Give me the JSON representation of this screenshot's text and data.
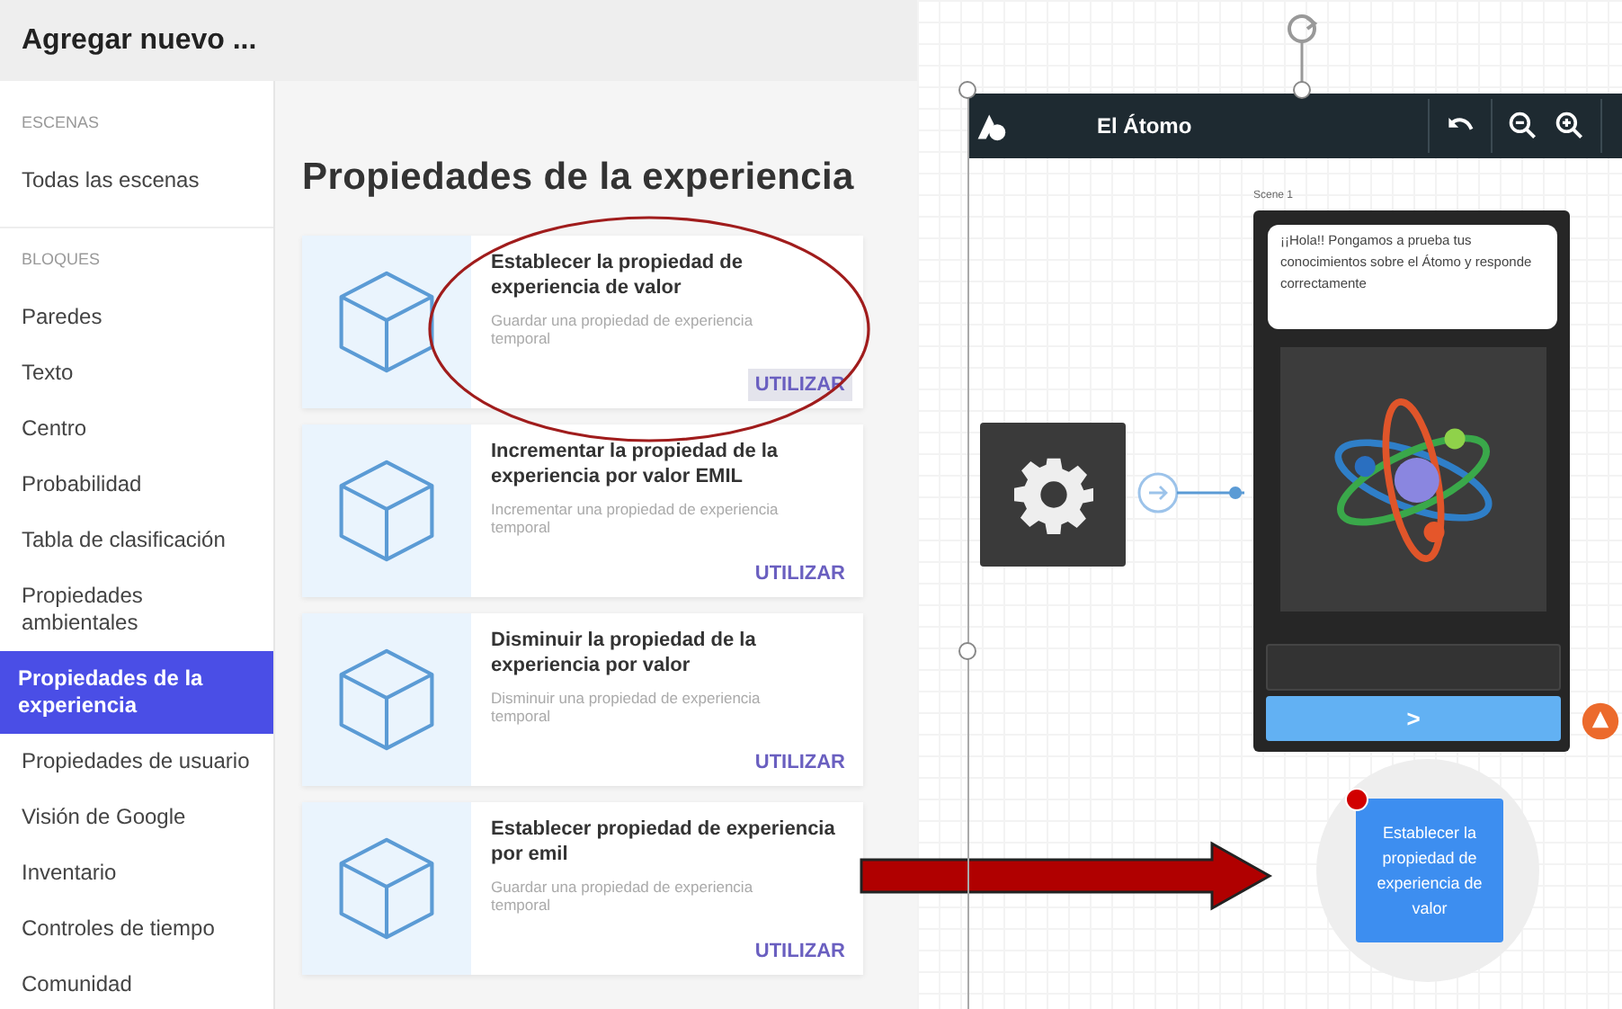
{
  "header": {
    "title": "Agregar nuevo ..."
  },
  "sidebar": {
    "sections": [
      {
        "heading": "ESCENAS",
        "items": [
          {
            "label": "Todas las escenas",
            "selected": false
          }
        ]
      },
      {
        "heading": "BLOQUES",
        "items": [
          {
            "label": "Paredes",
            "selected": false
          },
          {
            "label": "Texto",
            "selected": false
          },
          {
            "label": "Centro",
            "selected": false
          },
          {
            "label": "Probabilidad",
            "selected": false
          },
          {
            "label": "Tabla de clasificación",
            "selected": false
          },
          {
            "label": "Propiedades ambientales",
            "selected": false
          },
          {
            "label": "Propiedades de la experiencia",
            "selected": true
          },
          {
            "label": "Propiedades de usuario",
            "selected": false
          },
          {
            "label": "Visión de Google",
            "selected": false
          },
          {
            "label": "Inventario",
            "selected": false
          },
          {
            "label": "Controles de tiempo",
            "selected": false
          },
          {
            "label": "Comunidad",
            "selected": false
          }
        ]
      }
    ]
  },
  "content": {
    "heading": "Propiedades de la experiencia",
    "cards": [
      {
        "title": "Establecer la propiedad de experiencia de valor",
        "description": "Guardar una propiedad de experiencia temporal",
        "button": "UTILIZAR",
        "hovered": true
      },
      {
        "title": "Incrementar la propiedad de la experiencia por valor EMIL",
        "description": "Incrementar una propiedad de experiencia temporal",
        "button": "UTILIZAR",
        "hovered": false
      },
      {
        "title": "Disminuir la propiedad de la experiencia por valor",
        "description": "Disminuir una propiedad de experiencia temporal",
        "button": "UTILIZAR",
        "hovered": false
      },
      {
        "title": "Establecer propiedad de experiencia por emil",
        "description": "Guardar una propiedad de experiencia temporal",
        "button": "UTILIZAR",
        "hovered": false
      }
    ]
  },
  "editor": {
    "title": "El Átomo",
    "scene": {
      "label": "Scene 1",
      "message": "¡¡Hola!! Pongamos a prueba tus conocimientos sobre el Átomo y responde correctamente",
      "next_button": ">"
    },
    "node": {
      "label": "Establecer la propiedad de experiencia de valor"
    }
  }
}
